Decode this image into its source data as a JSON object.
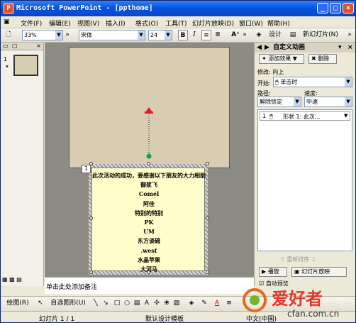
{
  "window": {
    "app_title": "Microsoft PowerPoint - [ppthome]",
    "app_icon": "P"
  },
  "menu": [
    "文件(F)",
    "编辑(E)",
    "视图(V)",
    "插入(I)",
    "格式(O)",
    "工具(T)",
    "幻灯片放映(D)",
    "窗口(W)",
    "帮助(H)"
  ],
  "toolbar": {
    "zoom": "33%",
    "font": "宋体",
    "size": "24",
    "bold": "B",
    "italic": "I",
    "design": "设计",
    "new_slide": "新幻灯片(N)"
  },
  "slides_pane": {
    "slide_number": "1"
  },
  "editor": {
    "popup_number": "1",
    "popup_lines": [
      "此次活动的成功，要感谢以下朋友的大力相助",
      "御浆飞",
      "Comel",
      "阿佳",
      "特别的特别",
      "PK",
      "UM",
      "东方谈硫",
      ".west",
      "水晶苹果",
      "大河马"
    ]
  },
  "notes": {
    "placeholder": "单击此处添加备注"
  },
  "task_pane": {
    "title": "自定义动画",
    "add_effect": "添加效果",
    "remove": "删除",
    "modify_label": "修改: 向上",
    "start_label": "开始:",
    "start_value": "单击时",
    "path_label": "路径:",
    "speed_label": "速度:",
    "path_value": "解除锁定",
    "speed_value": "中速",
    "item_number": "1",
    "item_text": "形状 1: 此次...",
    "reorder": "重新排序",
    "play": "播放",
    "slideshow": "幻灯片放映",
    "autopreview": "自动预览"
  },
  "drawbar": {
    "draw": "绘图(R)",
    "autoshapes": "自选图形(U)"
  },
  "status": {
    "slide": "幻灯片 1 / 1",
    "template": "默认设计模板",
    "lang": "中文(中国)"
  },
  "watermark": {
    "text": "爱好者",
    "site": "cfan.com.cn"
  },
  "colors": {
    "titlebar": "#0054e3",
    "slide_bg": "#d8ccb2",
    "popup_bg": "#ffffcc",
    "motion_arrow": "#e02020"
  }
}
